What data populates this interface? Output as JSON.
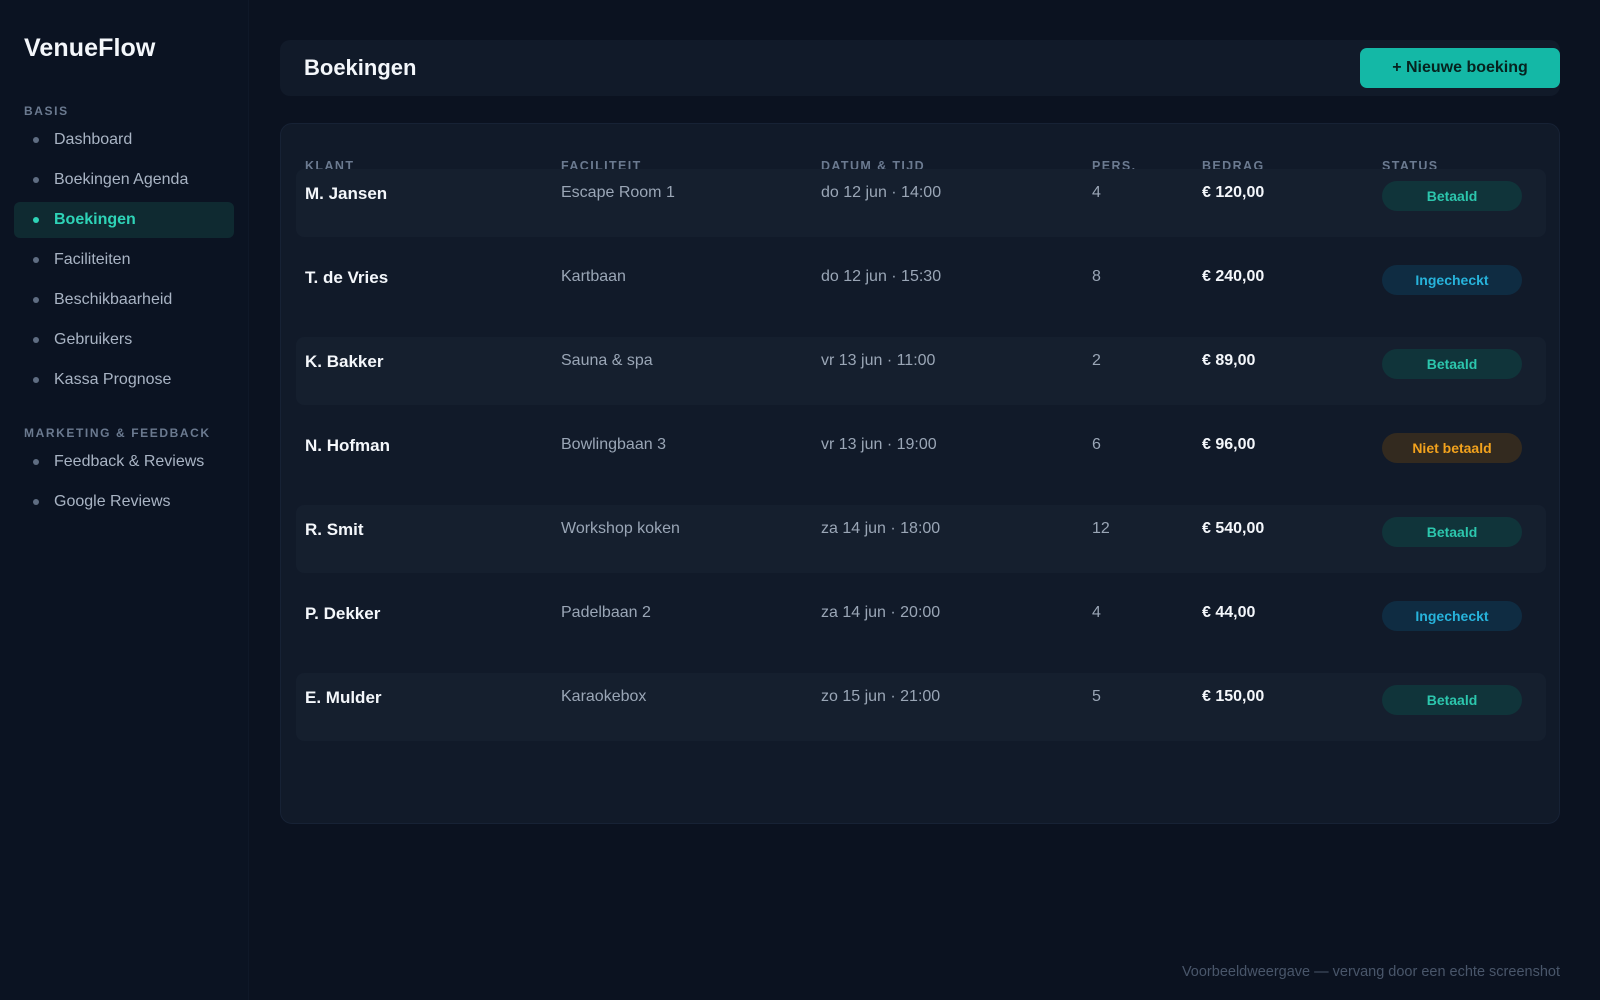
{
  "app": {
    "brand": "VenueFlow"
  },
  "sidebar": {
    "sections": [
      {
        "title": "BASIS",
        "items": [
          {
            "label": "Dashboard",
            "active": false
          },
          {
            "label": "Boekingen Agenda",
            "active": false
          },
          {
            "label": "Boekingen",
            "active": true
          },
          {
            "label": "Faciliteiten",
            "active": false
          },
          {
            "label": "Beschikbaarheid",
            "active": false
          },
          {
            "label": "Gebruikers",
            "active": false
          },
          {
            "label": "Kassa Prognose",
            "active": false
          }
        ]
      },
      {
        "title": "MARKETING & FEEDBACK",
        "items": [
          {
            "label": "Feedback & Reviews",
            "active": false
          },
          {
            "label": "Google Reviews",
            "active": false
          }
        ]
      }
    ]
  },
  "header": {
    "title": "Boekingen",
    "new_button_label": "+ Nieuwe boeking"
  },
  "table": {
    "columns": [
      "KLANT",
      "FACILITEIT",
      "DATUM & TIJD",
      "PERS.",
      "BEDRAG",
      "STATUS"
    ],
    "rows": [
      {
        "klant": "M. Jansen",
        "faciliteit": "Escape Room 1",
        "datum": "do 12 jun · 14:00",
        "pers": "4",
        "bedrag": "€ 120,00",
        "status": "Betaald",
        "status_kind": "betaald"
      },
      {
        "klant": "T. de Vries",
        "faciliteit": "Kartbaan",
        "datum": "do 12 jun · 15:30",
        "pers": "8",
        "bedrag": "€ 240,00",
        "status": "Ingecheckt",
        "status_kind": "ingecheckt"
      },
      {
        "klant": "K. Bakker",
        "faciliteit": "Sauna & spa",
        "datum": "vr 13 jun · 11:00",
        "pers": "2",
        "bedrag": "€ 89,00",
        "status": "Betaald",
        "status_kind": "betaald"
      },
      {
        "klant": "N. Hofman",
        "faciliteit": "Bowlingbaan 3",
        "datum": "vr 13 jun · 19:00",
        "pers": "6",
        "bedrag": "€ 96,00",
        "status": "Niet betaald",
        "status_kind": "niet"
      },
      {
        "klant": "R. Smit",
        "faciliteit": "Workshop koken",
        "datum": "za 14 jun · 18:00",
        "pers": "12",
        "bedrag": "€ 540,00",
        "status": "Betaald",
        "status_kind": "betaald"
      },
      {
        "klant": "P. Dekker",
        "faciliteit": "Padelbaan 2",
        "datum": "za 14 jun · 20:00",
        "pers": "4",
        "bedrag": "€ 44,00",
        "status": "Ingecheckt",
        "status_kind": "ingecheckt"
      },
      {
        "klant": "E. Mulder",
        "faciliteit": "Karaokebox",
        "datum": "zo 15 jun · 21:00",
        "pers": "5",
        "bedrag": "€ 150,00",
        "status": "Betaald",
        "status_kind": "betaald"
      }
    ]
  },
  "footer": {
    "note": "Voorbeeldweergave — vervang door een echte screenshot"
  },
  "colors": {
    "background": "#0b1220",
    "accent": "#14b8a6",
    "status_betaald": "#2cc6ad",
    "status_ingecheckt": "#27b3db",
    "status_niet_betaald": "#f2a21d"
  }
}
